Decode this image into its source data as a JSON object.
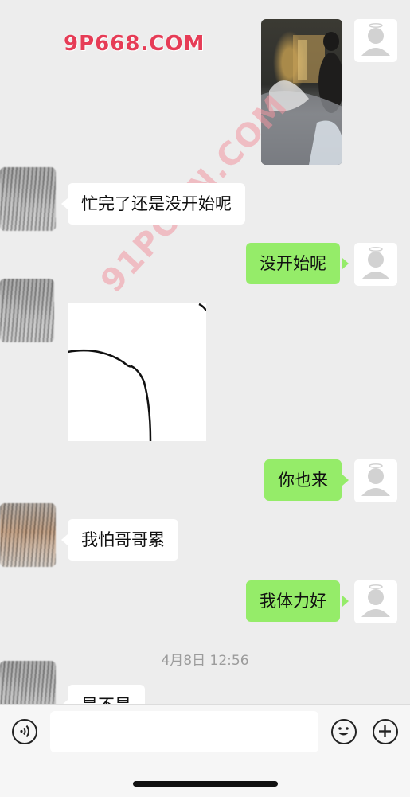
{
  "watermarks": [
    "9P668.COM",
    "91PORN.COM"
  ],
  "messages": [
    {
      "side": "in",
      "text": "忙完了还是没开始呢"
    },
    {
      "side": "out",
      "text": "没开始呢"
    },
    {
      "side": "out",
      "text": "你也来"
    },
    {
      "side": "in",
      "text": "我怕哥哥累"
    },
    {
      "side": "out",
      "text": "我体力好"
    },
    {
      "side": "in",
      "text": "是不是"
    }
  ],
  "timestamp": "4月8日 12:56",
  "input": {
    "value": "",
    "placeholder": ""
  },
  "icons": {
    "voice": "voice-icon",
    "emoji": "emoji-icon",
    "plus": "plus-icon"
  },
  "colors": {
    "outgoing_bubble": "#95ec69",
    "incoming_bubble": "#ffffff",
    "background": "#ededed"
  }
}
